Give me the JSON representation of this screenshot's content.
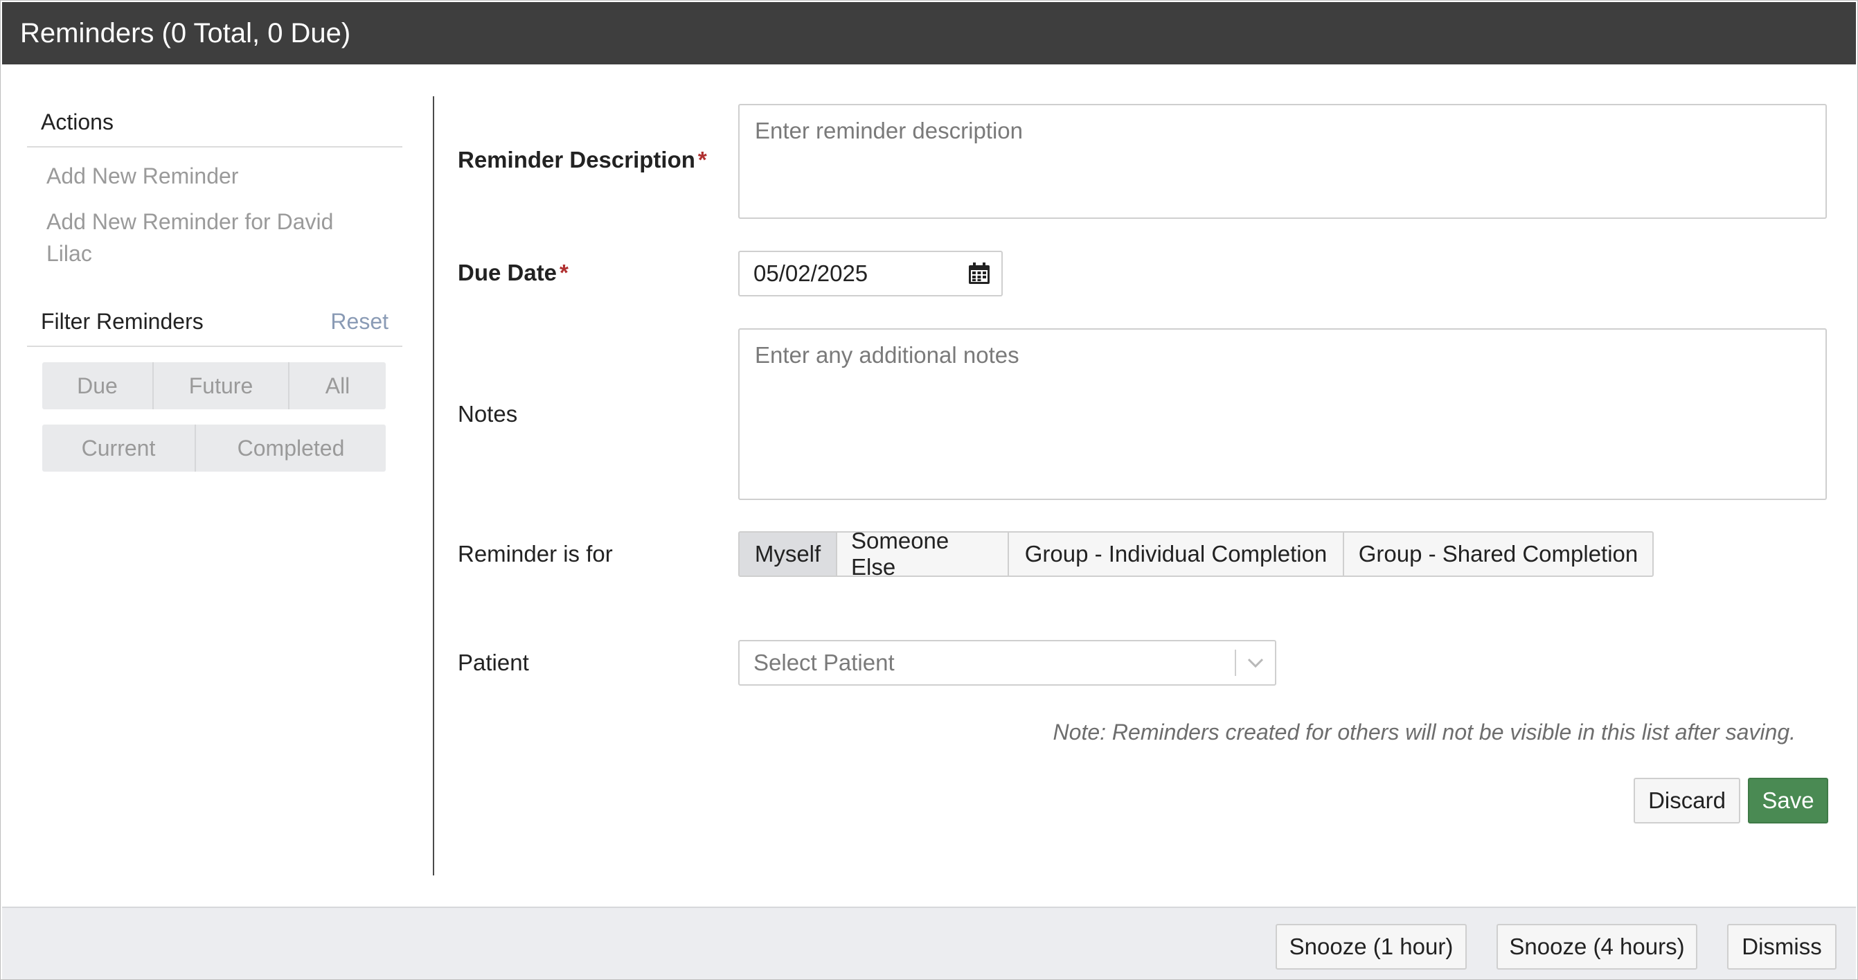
{
  "title": "Reminders (0 Total, 0 Due)",
  "sidebar": {
    "actions_heading": "Actions",
    "actions": [
      {
        "label": "Add New Reminder"
      },
      {
        "label": "Add New Reminder for David Lilac"
      }
    ],
    "filter_heading": "Filter Reminders",
    "reset_label": "Reset",
    "filter_row1": [
      "Due",
      "Future",
      "All"
    ],
    "filter_row2": [
      "Current",
      "Completed"
    ]
  },
  "form": {
    "description": {
      "label": "Reminder Description",
      "required": "*",
      "placeholder": "Enter reminder description"
    },
    "due_date": {
      "label": "Due Date",
      "required": "*",
      "value": "05/02/2025"
    },
    "notes": {
      "label": "Notes",
      "placeholder": "Enter any additional notes"
    },
    "reminder_for": {
      "label": "Reminder is for",
      "options": [
        "Myself",
        "Someone Else",
        "Group - Individual Completion",
        "Group - Shared Completion"
      ],
      "selected": "Myself"
    },
    "patient": {
      "label": "Patient",
      "placeholder": "Select Patient"
    },
    "note": "Note: Reminders created for others will not be visible in this list after saving.",
    "discard_label": "Discard",
    "save_label": "Save"
  },
  "footer": {
    "snooze_1h": "Snooze (1 hour)",
    "snooze_4h": "Snooze (4 hours)",
    "dismiss": "Dismiss"
  },
  "colors": {
    "titlebar": "#3e3e3e",
    "save": "#4a8a53",
    "required": "#b03030",
    "footer": "#ecedf0"
  },
  "icons": {
    "date_picker": "calendar-icon",
    "patient_dropdown": "chevron-down-icon"
  }
}
